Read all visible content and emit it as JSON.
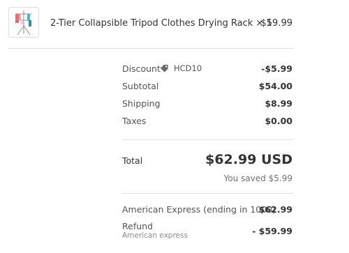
{
  "product": {
    "name": "2-Tier Collapsible Tripod Clothes Drying Rack",
    "quantity_label": "× 1",
    "price": "$59.99",
    "image": "drying-rack-thumbnail"
  },
  "summary": {
    "discount_label": "Discount",
    "discount_code": "HCD10",
    "discount_value": "-$5.99",
    "subtotal_label": "Subtotal",
    "subtotal_value": "$54.00",
    "shipping_label": "Shipping",
    "shipping_value": "$8.99",
    "taxes_label": "Taxes",
    "taxes_value": "$0.00"
  },
  "total": {
    "label": "Total",
    "amount": "$62.99 USD",
    "saved": "You saved $5.99"
  },
  "payments": [
    {
      "label": "American Express (ending in 1000)",
      "sublabel": "",
      "amount": "$62.99"
    },
    {
      "label": "Refund",
      "sublabel": "American express",
      "amount": "- $59.99"
    }
  ],
  "colors": {
    "divider": "#e1e1e1",
    "text_primary": "#333333",
    "text_secondary": "#545454",
    "text_muted": "#8a8a8a",
    "tag_icon": "#6b6b6b"
  }
}
